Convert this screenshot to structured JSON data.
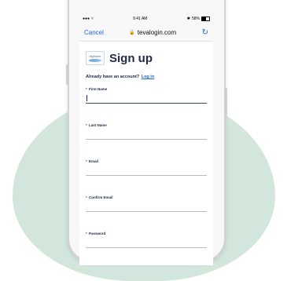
{
  "status_bar": {
    "carrier": "●●●",
    "wifi": "≈",
    "time": "9:41 AM",
    "bluetooth": "✱",
    "battery": "58%"
  },
  "browser": {
    "cancel_label": "Cancel",
    "url": "tevalogin.com",
    "reload_icon": "↻"
  },
  "brand": {
    "logo_text": "digihaler"
  },
  "page": {
    "title": "Sign up",
    "account_prompt": "Already have an account?",
    "login_link": "Log in"
  },
  "form": {
    "required_marker": "*",
    "fields": [
      {
        "label": "First Name",
        "value": ""
      },
      {
        "label": "Last Name",
        "value": ""
      },
      {
        "label": "Email",
        "value": ""
      },
      {
        "label": "Confirm Email",
        "value": ""
      },
      {
        "label": "Password",
        "value": ""
      }
    ]
  }
}
